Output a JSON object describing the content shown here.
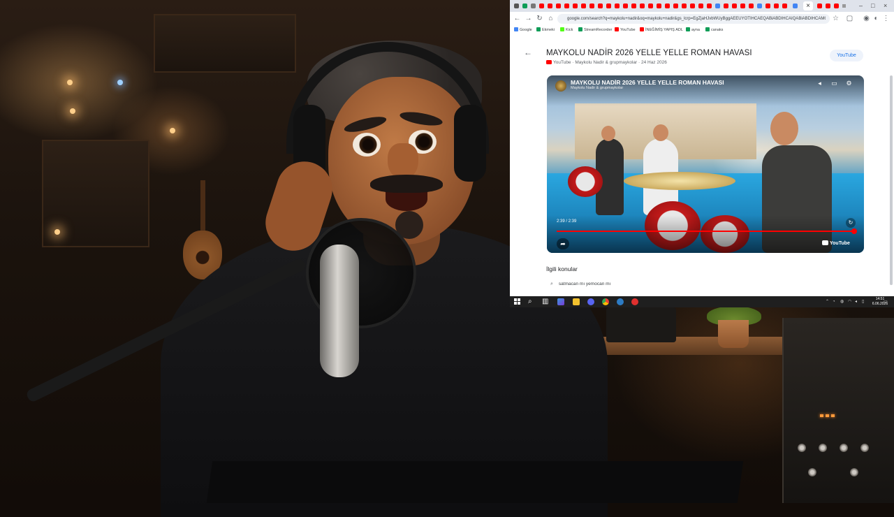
{
  "browser": {
    "url": "google.com/search?q=maykolu+nadir&oq=maykolu+nadir&gs_lcrp=EgZjaHJvbWUyBggAEEUYOTIHCAEQABiABDIHCAIQABiABDIHCAMQ",
    "bookmarks": [
      {
        "label": "Google",
        "color": "#4285f4"
      },
      {
        "label": "Ekmeki",
        "color": "#0f9d58"
      },
      {
        "label": "Kick",
        "color": "#53fc18"
      },
      {
        "label": "StreamRecorder",
        "color": "#0f9d58"
      },
      {
        "label": "YouTube",
        "color": "#ff0000"
      },
      {
        "label": "İNEĞİMİŞ YAPIŞ ADL",
        "color": "#ff0000"
      },
      {
        "label": "ayna",
        "color": "#0f9d58"
      },
      {
        "label": "canaks",
        "color": "#0f9d58"
      }
    ],
    "tab_close": "×",
    "window_controls": [
      "–",
      "□",
      "×"
    ]
  },
  "video": {
    "title": "MAYKOLU NADİR 2026 YELLE YELLE ROMAN HAVASI",
    "meta": "YouTube · Maykolu Nadir & grupmaykolar · 24 Haz 2026",
    "source_chip": "YouTube",
    "player_title": "MAYKOLU NADİR 2026 YELLE YELLE ROMAN HAVASI",
    "player_channel": "Maykolu Nadir & grupmaykolar",
    "time": "2:39 / 2:39",
    "progress": 1.0,
    "yt_logo": "YouTube"
  },
  "related": {
    "heading": "İlgili konular",
    "items": [
      "satmacan mı yemocan mı"
    ]
  },
  "taskbar": {
    "time": "14:51",
    "date": "6.06.2026"
  },
  "colors": {
    "accent": "#1a73e8",
    "youtube_red": "#ff0000",
    "taskbar": "#1f1f1f"
  }
}
